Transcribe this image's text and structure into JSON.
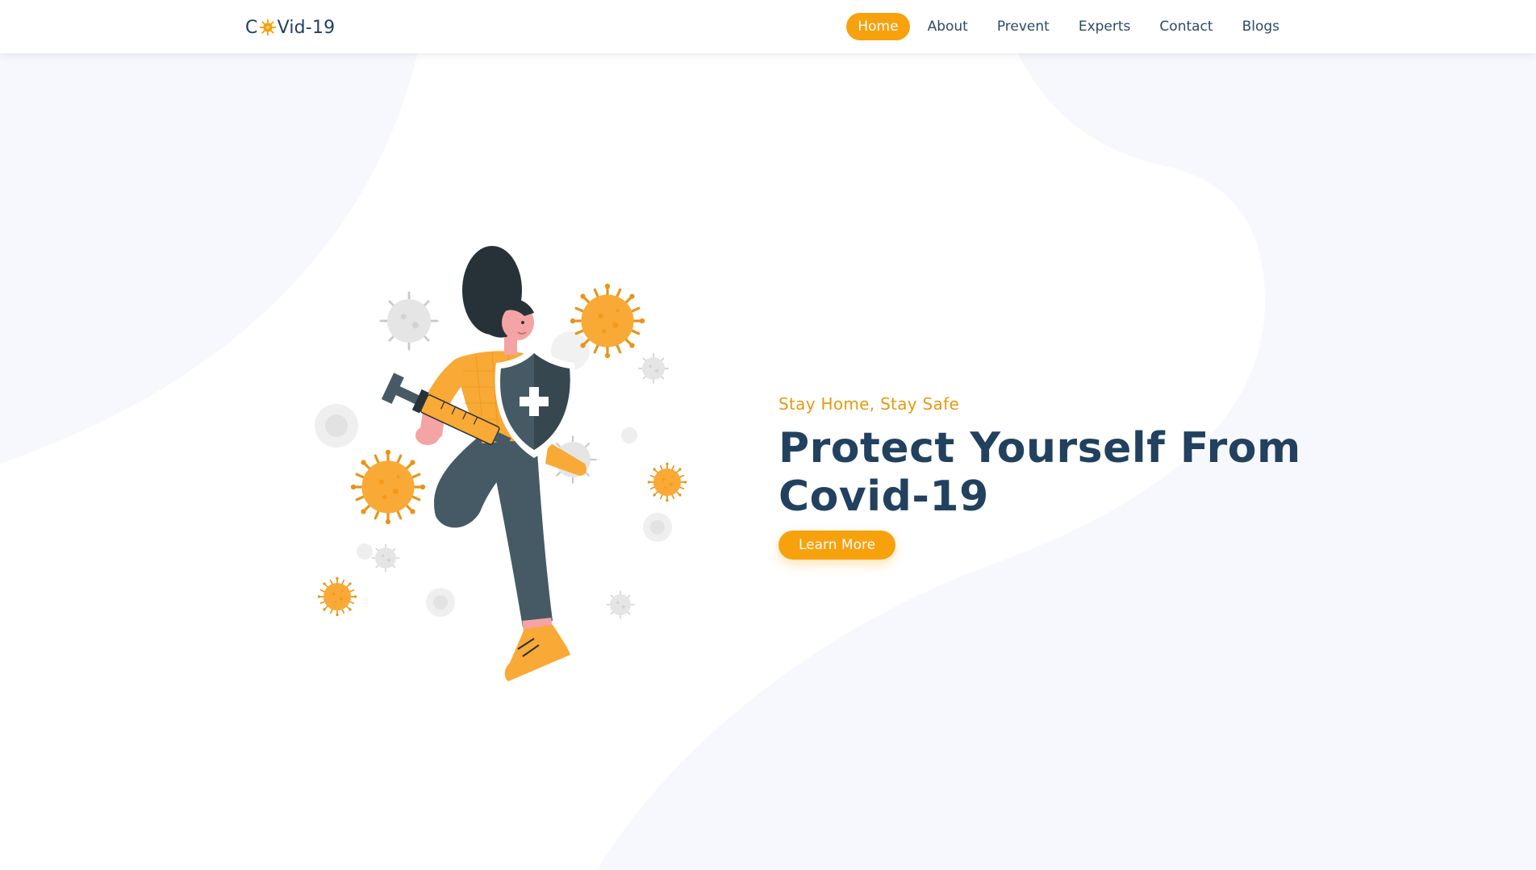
{
  "header": {
    "logo_prefix": "C",
    "logo_suffix": "Vid-19",
    "logo_icon": "virus-icon",
    "nav": [
      {
        "label": "Home",
        "active": true
      },
      {
        "label": "About",
        "active": false
      },
      {
        "label": "Prevent",
        "active": false
      },
      {
        "label": "Experts",
        "active": false
      },
      {
        "label": "Contact",
        "active": false
      },
      {
        "label": "Blogs",
        "active": false
      }
    ]
  },
  "hero": {
    "subtitle": "Stay Home, Stay Safe",
    "headline_line1": "Protect Yourself From",
    "headline_line2": "Covid-19",
    "cta_label": "Learn More",
    "illustration": "woman-with-shield-and-syringe-fighting-viruses"
  },
  "colors": {
    "accent": "#f7a10d",
    "heading": "#22415f",
    "nav_text": "#2c4a68",
    "background_shape": "#f7f8fd"
  }
}
